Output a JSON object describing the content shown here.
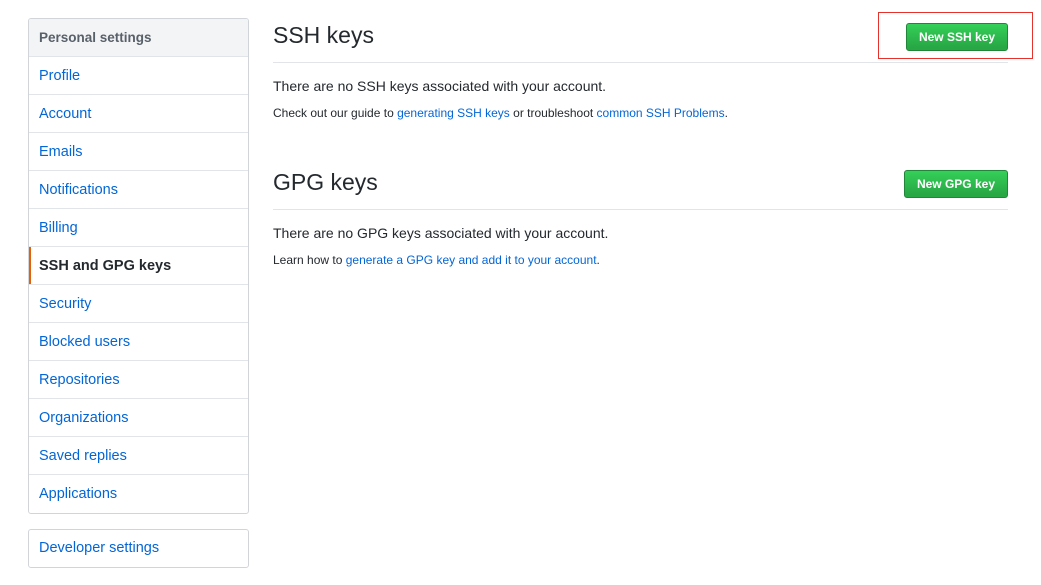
{
  "sidebar": {
    "heading": "Personal settings",
    "items": [
      {
        "label": "Profile"
      },
      {
        "label": "Account"
      },
      {
        "label": "Emails"
      },
      {
        "label": "Notifications"
      },
      {
        "label": "Billing"
      },
      {
        "label": "SSH and GPG keys"
      },
      {
        "label": "Security"
      },
      {
        "label": "Blocked users"
      },
      {
        "label": "Repositories"
      },
      {
        "label": "Organizations"
      },
      {
        "label": "Saved replies"
      },
      {
        "label": "Applications"
      }
    ],
    "developer_settings": "Developer settings"
  },
  "ssh": {
    "title": "SSH keys",
    "button": "New SSH key",
    "empty_text": "There are no SSH keys associated with your account.",
    "note_prefix": "Check out our guide to ",
    "note_link1": "generating SSH keys",
    "note_middle": " or troubleshoot ",
    "note_link2": "common SSH Problems",
    "note_suffix": "."
  },
  "gpg": {
    "title": "GPG keys",
    "button": "New GPG key",
    "empty_text": "There are no GPG keys associated with your account.",
    "note_prefix": "Learn how to ",
    "note_link": "generate a GPG key and add it to your account",
    "note_suffix": "."
  },
  "colors": {
    "link": "#0366d6",
    "primary_button": "#28a745",
    "selected_indicator": "#e36209",
    "highlight_box": "#e5322d"
  }
}
